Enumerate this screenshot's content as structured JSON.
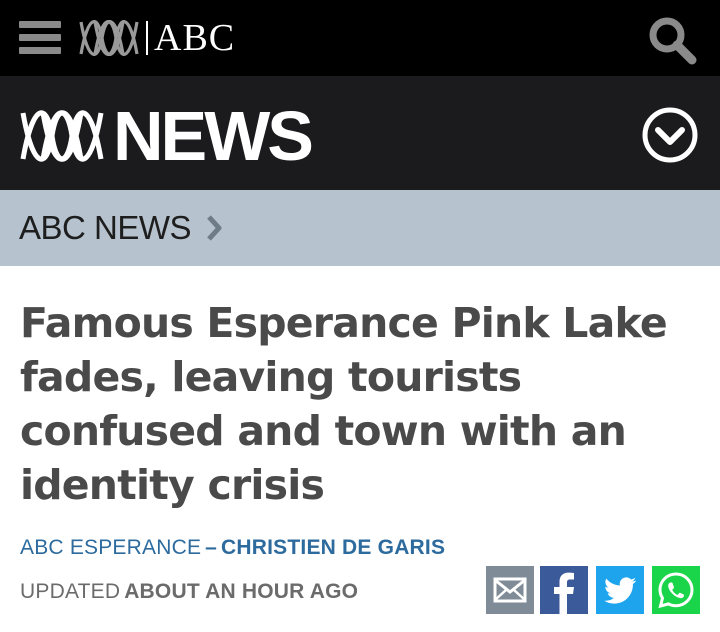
{
  "header": {
    "brand": "ABC",
    "menu_icon": "hamburger-menu-icon",
    "search_icon": "search-icon",
    "background": "#000000"
  },
  "news_header": {
    "title": "NEWS",
    "dropdown_icon": "chevron-down-circle-icon",
    "background": "#1b1a1d"
  },
  "breadcrumb": {
    "label": "ABC NEWS",
    "chevron_icon": "chevron-right-icon",
    "background": "#b6c3ce"
  },
  "article": {
    "headline": "Famous Esperance Pink Lake fades, leaving tourists confused and town with an identity crisis",
    "source": "ABC ESPERANCE",
    "separator": "–",
    "author": "CHRISTIEN DE GARIS",
    "updated_label": "UPDATED",
    "updated_time": "ABOUT AN HOUR AGO",
    "accent_color": "#2d6b9e"
  },
  "share": {
    "icons": [
      "email-icon",
      "facebook-icon",
      "twitter-icon",
      "whatsapp-icon"
    ],
    "colors": {
      "email": "#808b98",
      "facebook": "#3b5a99",
      "twitter": "#1da4ed",
      "whatsapp": "#1ad54a"
    }
  }
}
